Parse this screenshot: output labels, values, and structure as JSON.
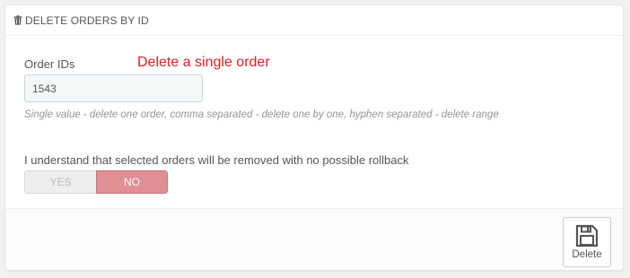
{
  "panel": {
    "title": "DELETE ORDERS BY ID",
    "title_icon": "trash-icon"
  },
  "form": {
    "order_ids_label": "Order IDs",
    "annotation": "Delete a single order",
    "annotation_color": "#e31b23",
    "order_ids_value": "1543",
    "help_text": "Single value - delete one order, comma separated - delete one by one, hyphen separated - delete range",
    "confirm_label": "I understand that selected orders will be removed with no possible rollback",
    "switch": {
      "yes_label": "YES",
      "no_label": "NO",
      "selected": "NO",
      "active_color": "#e08f95"
    }
  },
  "footer": {
    "delete_label": "Delete",
    "delete_icon": "save-icon"
  }
}
